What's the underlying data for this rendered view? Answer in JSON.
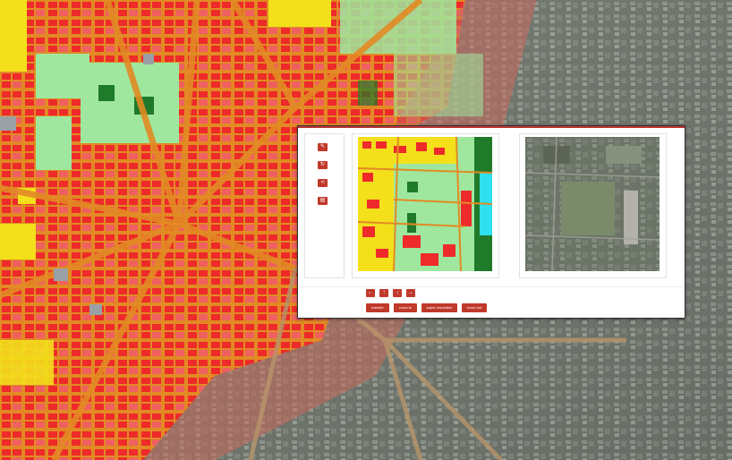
{
  "toolbar": {
    "icons": [
      "edit-icon",
      "refresh-icon",
      "share-icon",
      "save-icon"
    ]
  },
  "nav_arrows": {
    "left": "←",
    "up": "↑",
    "down": "↓",
    "right": "→"
  },
  "actions": {
    "transfer": "transfer",
    "zoom_in": "zoom-in",
    "super_resolution": "super-resolution",
    "zoom_out": "zoom-out"
  },
  "colors": {
    "accent": "#c0392b",
    "map_red": "#ee2a2a",
    "map_yellow": "#f3e01b",
    "map_green": "#9fe79f",
    "map_dark_green": "#1f7a2a",
    "map_cyan": "#2fe0ee",
    "road_orange": "#e28a24"
  }
}
